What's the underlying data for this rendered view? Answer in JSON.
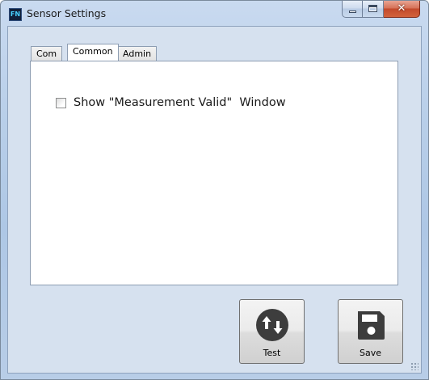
{
  "window": {
    "title": "Sensor Settings",
    "icon": "app-icon",
    "icon_text": "FN"
  },
  "tabs": [
    {
      "label": "Com",
      "selected": false
    },
    {
      "label": "Common",
      "selected": true
    },
    {
      "label": "Admin",
      "selected": false
    }
  ],
  "common_tab": {
    "checkbox_label": "Show \"Measurement Valid\"  Window",
    "checkbox_checked": false
  },
  "buttons": {
    "test": {
      "label": "Test",
      "icon": "up-down-arrows-icon"
    },
    "save": {
      "label": "Save",
      "icon": "floppy-disk-icon"
    }
  },
  "colors": {
    "icon_fill": "#3d3d3d",
    "close_button": "#c94a2c"
  }
}
